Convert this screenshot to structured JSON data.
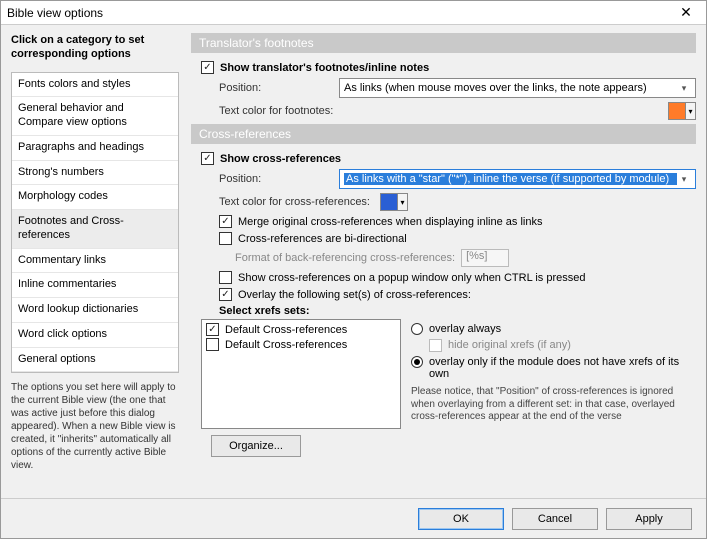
{
  "window": {
    "title": "Bible view options"
  },
  "sidebar": {
    "heading": "Click on a category to set corresponding options",
    "items": [
      "Fonts colors and styles",
      "General behavior and Compare view options",
      "Paragraphs and headings",
      "Strong's numbers",
      "Morphology codes",
      "Footnotes and Cross-references",
      "Commentary links",
      "Inline commentaries",
      "Word lookup dictionaries",
      "Word click options",
      "General options"
    ],
    "note": "The options you set here will apply to the current Bible view (the one that was active just before this dialog appeared). When a new Bible view is created, it \"inherits\" automatically all options of the currently active Bible view."
  },
  "footnotes": {
    "group_title": "Translator's footnotes",
    "show_label": "Show translator's footnotes/inline notes",
    "position_label": "Position:",
    "position_value": "As links (when mouse moves over the links, the note appears)",
    "color_label": "Text color for footnotes:",
    "color": "#ff7b29"
  },
  "xrefs": {
    "group_title": "Cross-references",
    "show_label": "Show cross-references",
    "position_label": "Position:",
    "position_value": "As links with a \"star\" (\"*\"), inline the verse (if supported by module)",
    "color_label": "Text color for cross-references:",
    "merge_label": "Merge original cross-references when displaying inline as links",
    "bidi_label": "Cross-references are bi-directional",
    "backref_label": "Format of back-referencing cross-references:",
    "backref_value": "[%s]",
    "popup_label": "Show cross-references on a popup window only when CTRL is pressed",
    "overlay_label": "Overlay the following set(s) of cross-references:",
    "sets_heading": "Select xrefs sets:",
    "sets": [
      {
        "label": "Default Cross-references",
        "checked": true
      },
      {
        "label": "Default Cross-references",
        "checked": false
      }
    ],
    "overlay_always": "overlay always",
    "hide_orig": "hide original xrefs (if any)",
    "overlay_only": "overlay only if the module does not have xrefs of its own",
    "overlay_note": "Please notice, that \"Position\" of cross-references is ignored when overlaying from a different set: in that case, overlayed cross-references appear at the end of the verse",
    "organize": "Organize..."
  },
  "buttons": {
    "ok": "OK",
    "cancel": "Cancel",
    "apply": "Apply"
  }
}
